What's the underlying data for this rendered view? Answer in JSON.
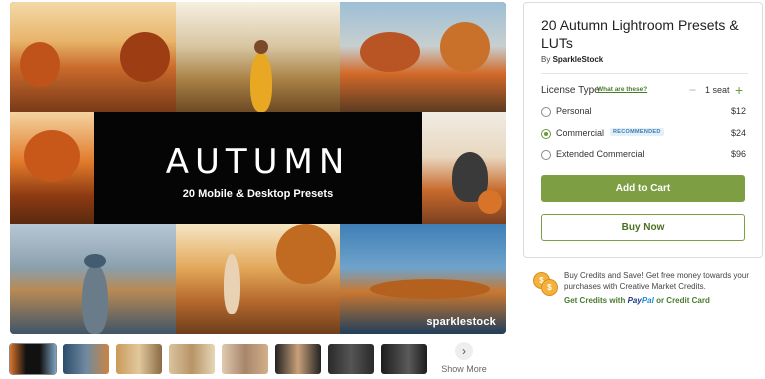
{
  "hero": {
    "title": "AUTUMN",
    "subtitle": "20 Mobile & Desktop Presets",
    "watermark": "sparklestock"
  },
  "thumbnails": {
    "count": 8,
    "active_index": 0,
    "show_more_icon": "chevron-right-icon",
    "show_more_label": "Show More"
  },
  "product": {
    "title": "20 Autumn Lightroom Presets & LUTs",
    "by_prefix": "By ",
    "author": "SparkleStock"
  },
  "license": {
    "label": "License Type",
    "link": "What are these?",
    "seats_minus": "−",
    "seats_value": "1 seat",
    "seats_plus": "+",
    "options": [
      {
        "name": "Personal",
        "price": "$12",
        "selected": false
      },
      {
        "name": "Commercial",
        "price": "$24",
        "selected": true,
        "badge": "RECOMMENDED"
      },
      {
        "name": "Extended Commercial",
        "price": "$96",
        "selected": false
      }
    ]
  },
  "actions": {
    "add_to_cart": "Add to Cart",
    "buy_now": "Buy Now"
  },
  "promo": {
    "text": "Buy Credits and Save! Get free money towards your purchases with Creative Market Credits.",
    "get_credits": "Get Credits with",
    "paypal_a": "Pay",
    "paypal_b": "Pal",
    "or_card": "or Credit Card"
  },
  "colors": {
    "accent": "#7e9e44",
    "link": "#4a7b2f",
    "badge_bg": "#e4f0f8",
    "badge_text": "#3b7cb0",
    "coin": "#f3b23c"
  }
}
